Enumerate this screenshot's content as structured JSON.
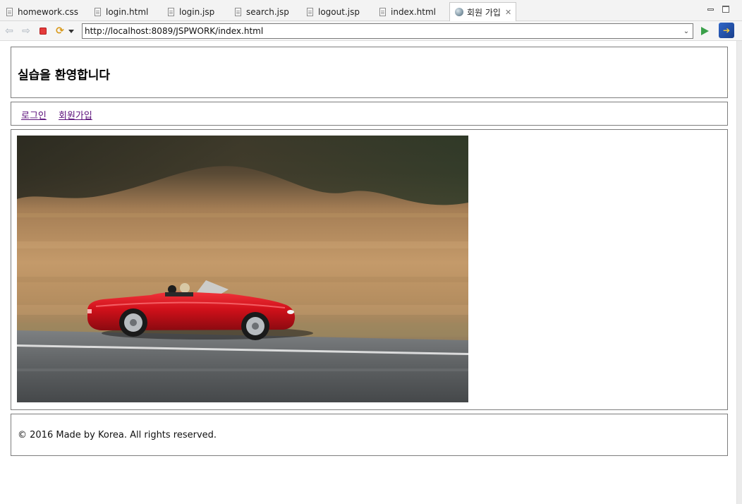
{
  "tabs": [
    {
      "label": "homework.css",
      "icon": "file-icon"
    },
    {
      "label": "login.html",
      "icon": "file-icon"
    },
    {
      "label": "login.jsp",
      "icon": "file-icon"
    },
    {
      "label": "search.jsp",
      "icon": "file-icon"
    },
    {
      "label": "logout.jsp",
      "icon": "file-icon"
    },
    {
      "label": "index.html",
      "icon": "file-icon"
    },
    {
      "label": "회원 가입",
      "icon": "globe-icon",
      "active": true
    }
  ],
  "toolbar": {
    "url": "http://localhost:8089/JSPWORK/index.html"
  },
  "page": {
    "header": {
      "title": "실습을 환영합니다"
    },
    "nav": {
      "links": [
        {
          "label": "로그인"
        },
        {
          "label": "회원가입"
        }
      ]
    },
    "content": {
      "image_subject": "red convertible car driving on road, motion-blurred golden hillside"
    },
    "footer": {
      "text": "© 2016 Made by Korea. All rights reserved."
    }
  },
  "colors": {
    "link_visited": "#5b0f7a",
    "border": "#7d7d7d",
    "car_red": "#d0101a"
  }
}
